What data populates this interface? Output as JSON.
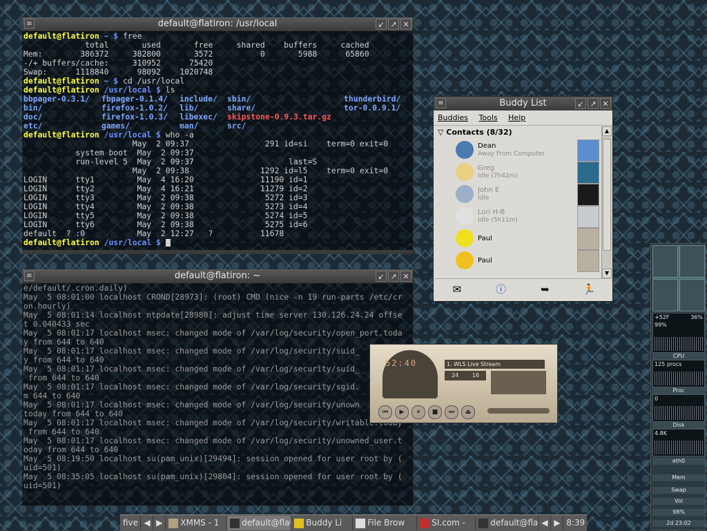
{
  "term1": {
    "title": "default@flatiron: /usr/local",
    "lines": [
      {
        "user": "default@flatiron",
        "path": "~",
        "cmd": "free"
      },
      {
        "text": "             total       used       free     shared    buffers     cached"
      },
      {
        "text": "Mem:        386372     382800       3572          0       5988      65860"
      },
      {
        "text": "-/+ buffers/cache:     310952      75420"
      },
      {
        "text": "Swap:      1118840      98092    1020748"
      },
      {
        "user": "default@flatiron",
        "path": "~",
        "cmd": "cd /usr/local"
      },
      {
        "user": "default@flatiron",
        "path": "/usr/local",
        "cmd": "ls"
      },
      {
        "ls": [
          "bbpager-0.3.1/",
          "fbpager-0.1.4/",
          "include/",
          "sbin/",
          "",
          "thunderbird/"
        ]
      },
      {
        "ls": [
          "bin/",
          "firefox-1.0.2/",
          "lib/",
          "share/",
          "",
          "tor-0.0.9.1/"
        ]
      },
      {
        "ls": [
          "doc/",
          "firefox-1.0.3/",
          "libexec/",
          "skipstone-0.9.3.tar.gz",
          "",
          ""
        ]
      },
      {
        "ls": [
          "etc/",
          "games/",
          "man/",
          "src/",
          "",
          ""
        ]
      },
      {
        "user": "default@flatiron",
        "path": "/usr/local",
        "cmd": "who -a"
      },
      {
        "text": "                       May  2 09:37                291 id=si    term=0 exit=0"
      },
      {
        "text": "           system boot  May  2 09:37"
      },
      {
        "text": "           run-level 5  May  2 09:37                    last=S"
      },
      {
        "text": "                       May  2 09:38               1292 id=l5    term=0 exit=0"
      },
      {
        "text": "LOGIN      tty1         May  4 16:20              11190 id=1"
      },
      {
        "text": "LOGIN      tty2         May  4 16:21              11279 id=2"
      },
      {
        "text": "LOGIN      tty3         May  2 09:38               5272 id=3"
      },
      {
        "text": "LOGIN      tty4         May  2 09:38               5273 id=4"
      },
      {
        "text": "LOGIN      tty5         May  2 09:38               5274 id=5"
      },
      {
        "text": "LOGIN      tty6         May  2 09:38               5275 id=6"
      },
      {
        "text": "default  ? :0           May  2 12:27   ?          11678"
      },
      {
        "user": "default@flatiron",
        "path": "/usr/local",
        "cmd": "",
        "cursor": true
      }
    ]
  },
  "term2": {
    "title": "default@flatiron: ~",
    "lines": [
      "e/default/.cron.daily)",
      "May  5 08:01:00 localhost CROND[28973]: (root) CMD (nice -n 19 run-parts /etc/cr",
      "on.hourly)",
      "May  5 08:01:14 localhost ntpdate[28980]: adjust time server 130.126.24.24 offse",
      "t 0.040433 sec",
      "May  5 08:01:17 localhost msec: changed mode of /var/log/security/open_port.toda",
      "y from 644 to 640",
      "May  5 08:01:17 localhost msec: changed mode of /var/log/security/suid_",
      "y from 644 to 640",
      "May  5 08:01:17 localhost msec: changed mode of /var/log/security/suid_",
      " from 644 to 640",
      "May  5 08:01:17 localhost msec: changed mode of /var/log/security/sgid.",
      "m 644 to 640",
      "May  5 08:01:17 localhost msec: changed mode of /var/log/security/unown",
      "today from 644 to 640",
      "May  5 08:01:17 localhost msec: changed mode of /var/log/security/writable.today",
      " from 644 to 640",
      "May  5 08:01:17 localhost msec: changed mode of /var/log/security/unowned_user.t",
      "oday from 644 to 640",
      "May  5 08:19:50 localhost su(pam_unix)[29494]: session opened for user root by (",
      "uid=501)",
      "May  5 08:35:05 localhost su(pam_unix)[29804]: session opened for user root by (",
      "uid=501)",
      ""
    ]
  },
  "buddy": {
    "title": "Buddy List",
    "menu": [
      "Buddies",
      "Tools",
      "Help"
    ],
    "group": "Contacts (8/32)",
    "items": [
      {
        "name": "Dean",
        "status": "Away From Computer",
        "idle": false
      },
      {
        "name": "Greg",
        "status": "Idle (7h42m)",
        "idle": true
      },
      {
        "name": "John E",
        "status": "Idle",
        "idle": true
      },
      {
        "name": "Lori H-B",
        "status": "Idle (5h11m)",
        "idle": true
      },
      {
        "name": "Paul",
        "status": "",
        "idle": false
      },
      {
        "name": "Paul",
        "status": "",
        "idle": false
      }
    ]
  },
  "xmms": {
    "time": "52:40",
    "song": "1. WLS Live Stream",
    "kbps": "24",
    "khz": "16"
  },
  "gkrellm": {
    "temp": "+52F",
    "percent": "36%",
    "cpu_pct": "99%",
    "cpu": "CPU",
    "procs": "125 procs",
    "proc": "Proc",
    "proc_val": "0",
    "disk": "Disk",
    "disk_val": "4.8K",
    "eth": "eth0",
    "mem": "Mem",
    "swap": "Swap",
    "vol": "Vol",
    "vol_pct": "98%",
    "uptime": "2d 23:02"
  },
  "taskbar": {
    "workspace": "five",
    "tasks": [
      "XMMS - 1",
      "default@flati",
      "Buddy Li",
      "File Brow",
      "SI.com -",
      "default@flati"
    ],
    "clock": "8:39"
  }
}
